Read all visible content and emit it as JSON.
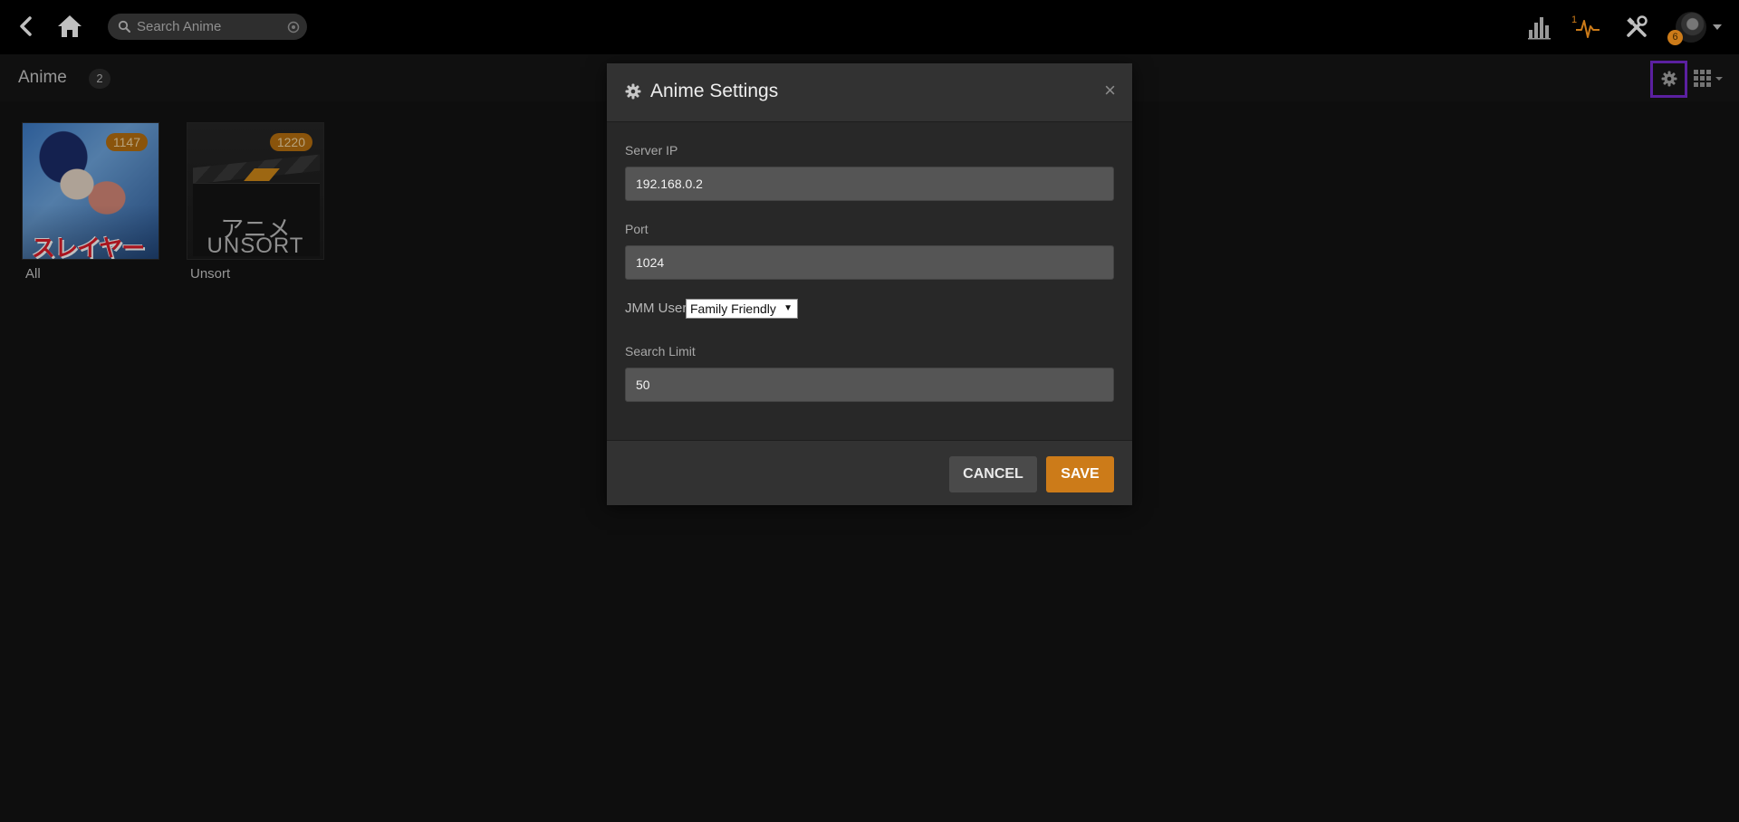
{
  "topbar": {
    "search_placeholder": "Search Anime",
    "activity_count": "1",
    "notification_badge": "6",
    "icons": [
      "back-icon",
      "home-icon",
      "search-icon",
      "advanced-search-icon",
      "stats-icon",
      "activity-icon",
      "tools-icon",
      "avatar",
      "caret-down-icon"
    ]
  },
  "section": {
    "title": "Anime",
    "count": "2"
  },
  "items": [
    {
      "label": "All",
      "count": "1147",
      "poster_title": "スレイヤーズ"
    },
    {
      "label": "Unsort",
      "count": "1220",
      "poster_jp": "アニメ",
      "poster_en": "UNSORT"
    }
  ],
  "modal": {
    "title": "Anime Settings",
    "close_label": "×",
    "server_ip_label": "Server IP",
    "server_ip_value": "192.168.0.2",
    "port_label": "Port",
    "port_value": "1024",
    "jmm_user_label": "JMM User",
    "jmm_user_value": "Family Friendly",
    "search_limit_label": "Search Limit",
    "search_limit_value": "50",
    "cancel_label": "CANCEL",
    "save_label": "SAVE"
  },
  "colors": {
    "accent": "#cc7b19",
    "highlight_border": "#7a2bd6",
    "background": "#131313"
  }
}
